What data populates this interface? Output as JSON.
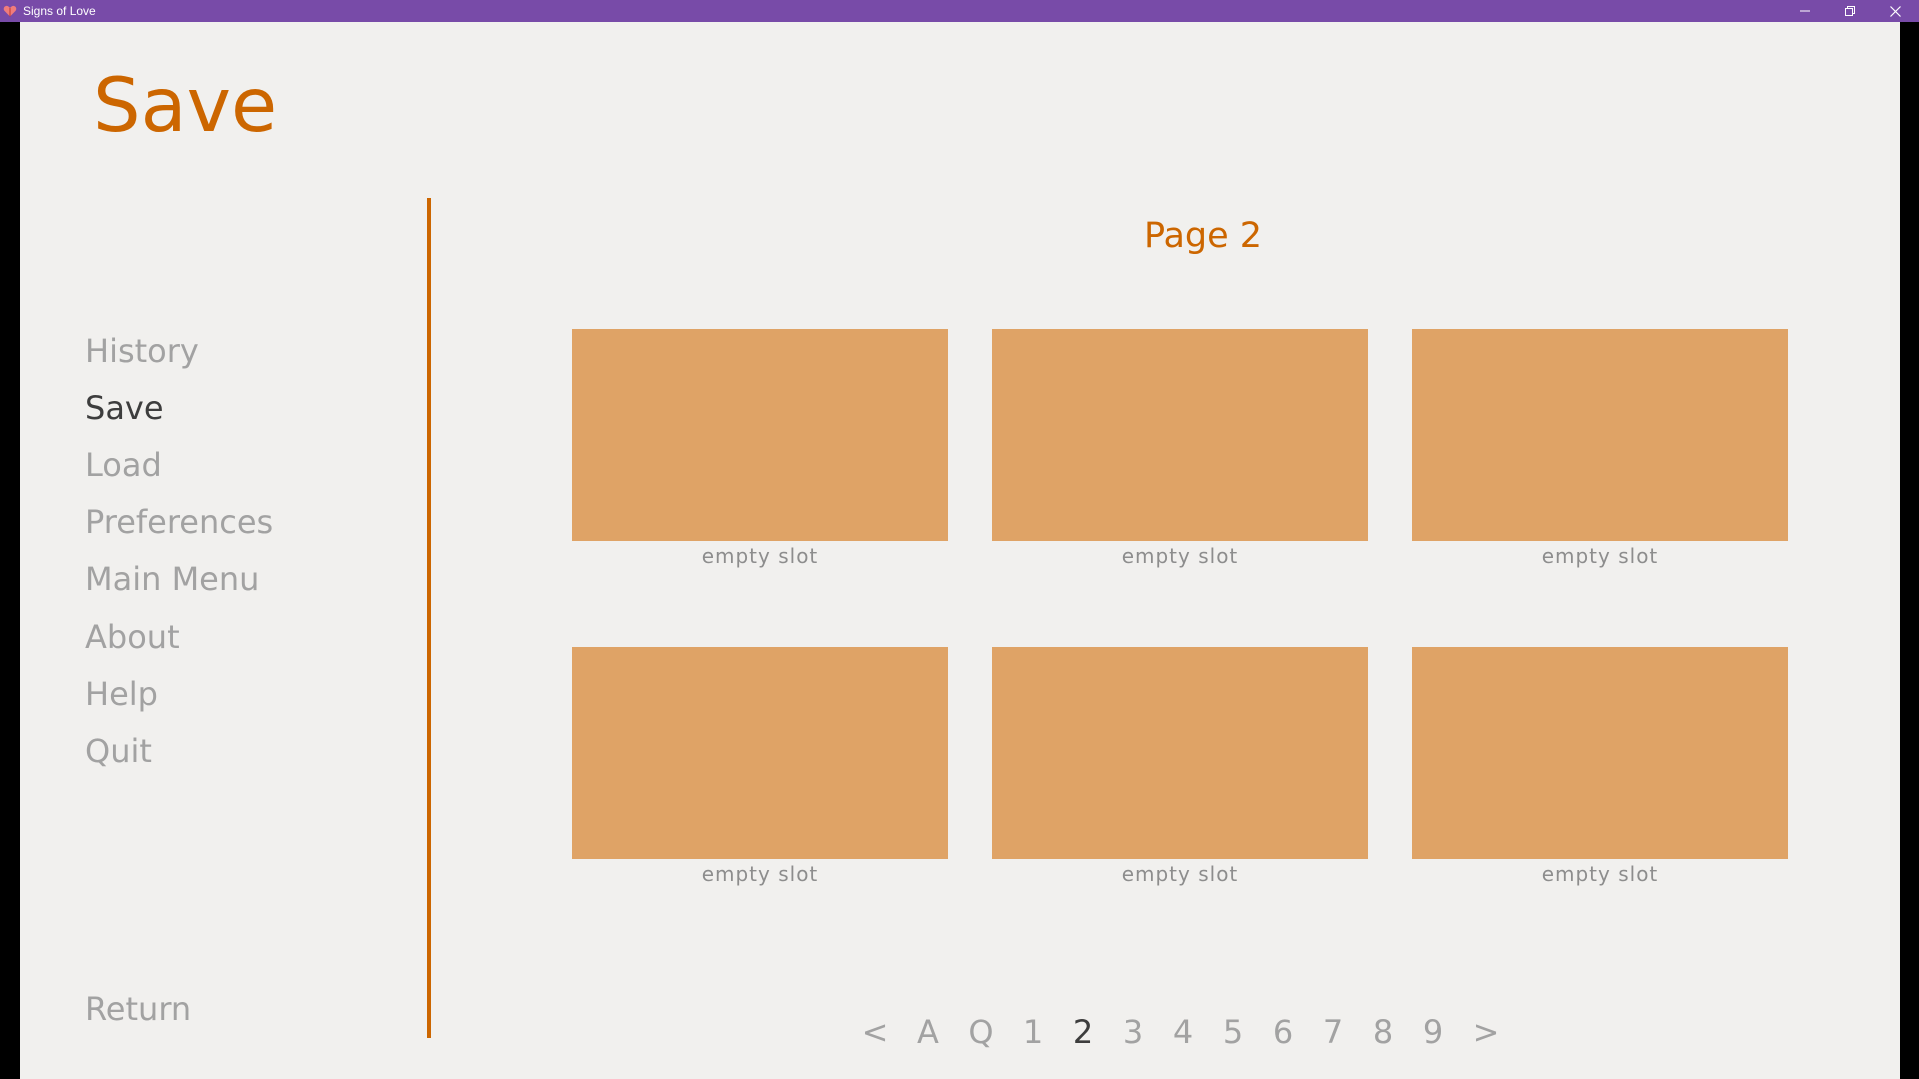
{
  "window": {
    "title": "Signs of Love",
    "titlebar_color": "#784ba8"
  },
  "screen": {
    "title": "Save",
    "accent_color": "#cc6600"
  },
  "nav": {
    "items": [
      {
        "label": "History"
      },
      {
        "label": "Save",
        "active": true
      },
      {
        "label": "Load"
      },
      {
        "label": "Preferences"
      },
      {
        "label": "Main Menu"
      },
      {
        "label": "About"
      },
      {
        "label": "Help"
      },
      {
        "label": "Quit"
      }
    ],
    "return_label": "Return"
  },
  "main": {
    "page_title": "Page 2",
    "slots": [
      {
        "label": "empty slot"
      },
      {
        "label": "empty slot"
      },
      {
        "label": "empty slot"
      },
      {
        "label": "empty slot"
      },
      {
        "label": "empty slot"
      },
      {
        "label": "empty slot"
      }
    ],
    "slot_color": "#dfa366",
    "pager": [
      {
        "label": "<"
      },
      {
        "label": "A"
      },
      {
        "label": "Q"
      },
      {
        "label": "1"
      },
      {
        "label": "2",
        "active": true
      },
      {
        "label": "3"
      },
      {
        "label": "4"
      },
      {
        "label": "5"
      },
      {
        "label": "6"
      },
      {
        "label": "7"
      },
      {
        "label": "8"
      },
      {
        "label": "9"
      },
      {
        "label": ">"
      }
    ]
  }
}
